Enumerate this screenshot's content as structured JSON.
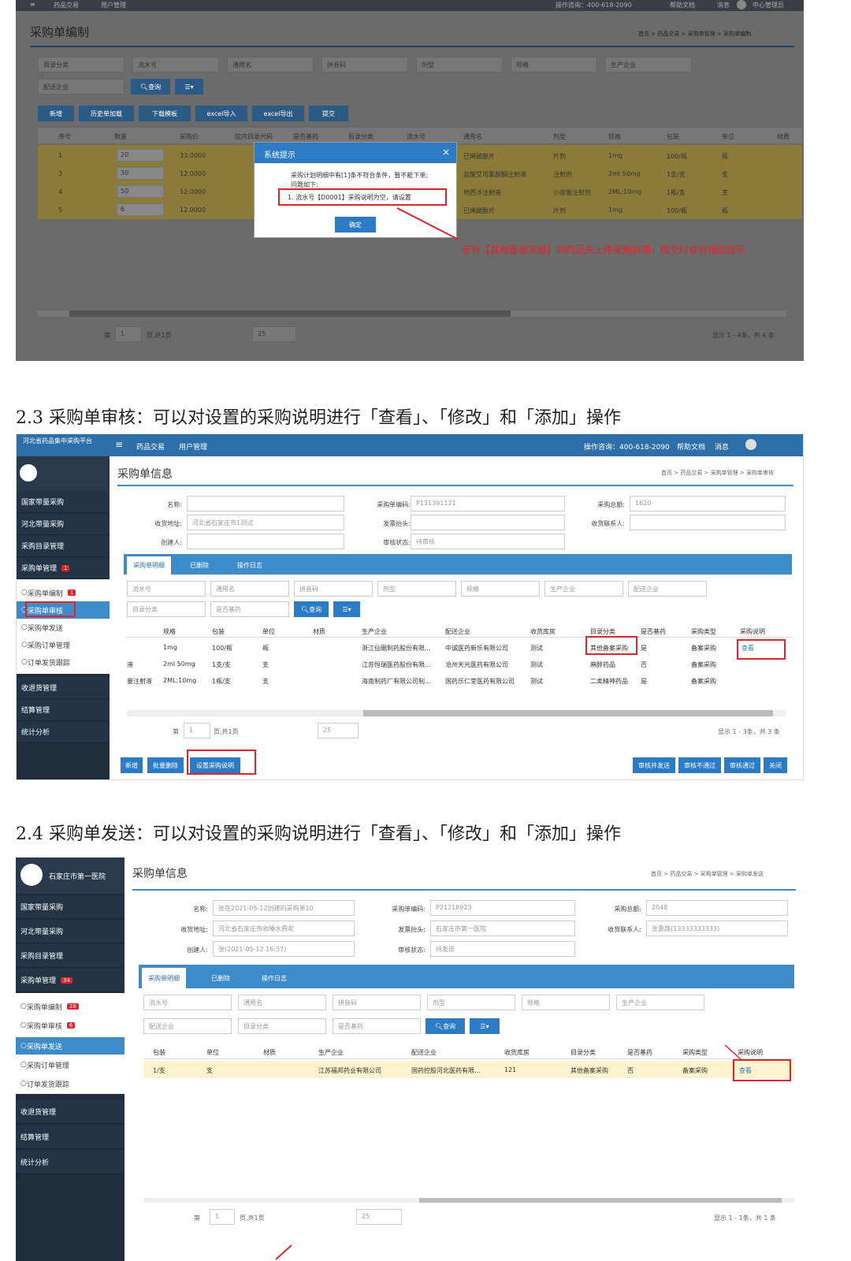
{
  "section1": {
    "topbar": {
      "menu1": "药品交易",
      "menu2": "用户管理",
      "phone": "操作咨询：400-618-2090",
      "help": "帮助文档",
      "msg": "消息",
      "user": "中心管理员"
    },
    "page_title": "采购单编制",
    "breadcrumb": "首页 > 药品交易 > 采购单管理 > 采购单编制",
    "filters": [
      "目录分类",
      "流水号",
      "通用名",
      "拼音码",
      "剂型",
      "规格",
      "生产企业",
      "配送企业"
    ],
    "search_btn": "查询",
    "toolbar": [
      "新增",
      "历史单加载",
      "下载模板",
      "excel导入",
      "excel导出",
      "提交"
    ],
    "columns": [
      "序号",
      "数量",
      "采购价",
      "院内目录代码",
      "是否基药",
      "目录分类",
      "流水号",
      "通用名",
      "剂型",
      "规格",
      "包装",
      "单位",
      "材质"
    ],
    "rows": [
      {
        "no": "1",
        "qty": "20",
        "price": "33.0000",
        "name": "已烯雌酚片",
        "form": "片剂",
        "spec": "1mg",
        "pack": "100/瓶",
        "unit": "瓶"
      },
      {
        "no": "3",
        "qty": "30",
        "price": "12.0000",
        "name": "盐酸艾司氯胺酮注射液",
        "form": "注射剂",
        "spec": "2ml 50mg",
        "pack": "1支/支",
        "unit": "支"
      },
      {
        "no": "4",
        "qty": "50",
        "price": "12.0000",
        "name": "地西泮注射液",
        "form": "小容量注射剂",
        "spec": "2ML:10mg",
        "pack": "1瓶/支",
        "unit": "支"
      },
      {
        "no": "5",
        "qty": "6",
        "price": "12.0000",
        "name": "已烯雌酚片",
        "form": "片剂",
        "spec": "1mg",
        "pack": "100/瓶",
        "unit": "瓶"
      }
    ],
    "dialog": {
      "title": "系统提示",
      "line1": "采购计划明细中有[1]条不符合条件，暂不能下单;",
      "line2": "问题如下:",
      "item": "1. 流水号【D0001】采购说明为空，请设置",
      "ok": "确定"
    },
    "annotation": "若有【其他备案采购】的药品未上传采购说明，提交时会有相应提示",
    "pager": {
      "page_label": "第",
      "page": "1",
      "total": "页,共1页",
      "size": "25",
      "summary": "显示 1 - 4条，共 4 条"
    }
  },
  "heading2": "2.3 采购单审核：可以对设置的采购说明进行「查看」、「修改」和「添加」操作",
  "section2": {
    "brand": "河北省药品集中采购平台",
    "topbar": {
      "menu1": "药品交易",
      "menu2": "用户管理",
      "phone": "操作咨询：400-618-2090",
      "help": "帮助文档",
      "msg": "消息"
    },
    "sidebar": [
      {
        "label": "国家带量采购"
      },
      {
        "label": "河北带量采购"
      },
      {
        "label": "采购目录管理"
      },
      {
        "label": "采购单管理",
        "badge": "1"
      }
    ],
    "subitems": [
      {
        "label": "采购单编制",
        "badge": "1"
      },
      {
        "label": "采购单审核"
      },
      {
        "label": "采购单发送"
      },
      {
        "label": "采购订单管理"
      },
      {
        "label": "订单发货跟踪"
      }
    ],
    "sidebar2": [
      {
        "label": "收退货管理"
      },
      {
        "label": "结算管理"
      },
      {
        "label": "统计分析"
      }
    ],
    "page_title": "采购单信息",
    "breadcrumb": "首页 > 药品交易 > 采购单管理 > 采购单审核",
    "form": {
      "name_label": "名称:",
      "code_label": "采购单编码:",
      "code": "P131391121",
      "total_label": "采购总额:",
      "total": "1620",
      "addr_label": "收货地址:",
      "addr": "河北省石家庄市1测试",
      "invoice_label": "发票抬头:",
      "contact_label": "收货联系人:",
      "creator_label": "创建人:",
      "status_label": "审核状态:",
      "status": "待审核"
    },
    "tabs": [
      "采购单明细",
      "已删除",
      "操作日志"
    ],
    "filters": [
      "流水号",
      "通用名",
      "拼音码",
      "剂型",
      "规格",
      "生产企业",
      "配送企业",
      "目录分类",
      "是否基药"
    ],
    "search_btn": "查询",
    "columns": [
      "规格",
      "包装",
      "单位",
      "材质",
      "生产企业",
      "配送企业",
      "收货库房",
      "目录分类",
      "是否基药",
      "采购类型",
      "采购说明"
    ],
    "rows": [
      {
        "lead": "",
        "spec": "1mg",
        "pack": "100/瓶",
        "unit": "瓶",
        "maker": "浙江仙琚制药股份有限...",
        "dist": "中诚医药新乐有限公司",
        "store": "测试",
        "cat": "其他备案采购",
        "base": "是",
        "type": "备案采购",
        "note": "查看"
      },
      {
        "lead": "液",
        "spec": "2ml 50mg",
        "pack": "1支/支",
        "unit": "支",
        "maker": "江苏恒瑞医药股份有限...",
        "dist": "沧州天元医药有限公司",
        "store": "测试",
        "cat": "麻醉药品",
        "base": "否",
        "type": "备案采购",
        "note": ""
      },
      {
        "lead": "量注射液",
        "spec": "2ML:10mg",
        "pack": "1瓶/支",
        "unit": "支",
        "maker": "海南制药厂有限公司制...",
        "dist": "国药乐仁堂医药有限公司",
        "store": "测试",
        "cat": "二类精神药品",
        "base": "是",
        "type": "备案采购",
        "note": ""
      }
    ],
    "pager": {
      "page_label": "第",
      "page": "1",
      "total": "页,共1页",
      "size": "25",
      "summary": "显示 1 - 3条，共 3 条"
    },
    "bottom_left": [
      "新增",
      "批量删除",
      "设置采购说明"
    ],
    "bottom_right": [
      "审核并发送",
      "审核不通过",
      "审核通过",
      "关闭"
    ]
  },
  "heading3": "2.4 采购单发送：可以对设置的采购说明进行「查看」、「修改」和「添加」操作",
  "section3": {
    "user": "石家庄市第一医院",
    "sidebar": [
      {
        "label": "国家带量采购"
      },
      {
        "label": "河北带量采购"
      },
      {
        "label": "采购目录管理"
      },
      {
        "label": "采购单管理",
        "badge": "34"
      }
    ],
    "subitems": [
      {
        "label": "采购单编制",
        "badge": "28"
      },
      {
        "label": "采购单审核",
        "badge": "6"
      },
      {
        "label": "采购单发送"
      },
      {
        "label": "采购订单管理"
      },
      {
        "label": "订单发货跟踪"
      }
    ],
    "sidebar2": [
      {
        "label": "收退货管理"
      },
      {
        "label": "结算管理"
      },
      {
        "label": "统计分析"
      }
    ],
    "page_title": "采购单信息",
    "breadcrumb": "首页 > 药品交易 > 采购单管理 > 采购单发送",
    "form": {
      "name_label": "名称:",
      "name": "张在2021-05-12创建的采购单10",
      "code_label": "采购单编码:",
      "code": "P21218923",
      "total_label": "采购总额:",
      "total": "2048",
      "addr_label": "收货地址:",
      "addr": "河北省石家庄市收睡水费呢",
      "invoice_label": "发票抬头:",
      "invoice": "石家庄市第一医院",
      "contact_label": "收货联系人:",
      "contact": "张惠路(13333333333)",
      "creator_label": "创建人:",
      "creator": "张(2021-05-12 16:37)",
      "status_label": "审核状态:",
      "status": "待发送"
    },
    "tabs": [
      "采购单明细",
      "已删除",
      "操作日志"
    ],
    "filters": [
      "流水号",
      "通用名",
      "拼音码",
      "剂型",
      "规格",
      "生产企业",
      "配送企业",
      "目录分类",
      "是否基药"
    ],
    "search_btn": "查询",
    "columns": [
      "包装",
      "单位",
      "材质",
      "生产企业",
      "配送企业",
      "收货库房",
      "目录分类",
      "是否基药",
      "采购类型",
      "采购说明"
    ],
    "rows": [
      {
        "pack": "1/支",
        "unit": "支",
        "mat": "",
        "maker": "江苏福邦药业有限公司",
        "dist": "国药控股河北医药有限...",
        "store": "121",
        "cat": "其他备案采购",
        "base": "否",
        "type": "备案采购",
        "note": "查看"
      }
    ],
    "pager": {
      "page_label": "第",
      "page": "1",
      "total": "页,共1页",
      "size": "25",
      "summary": "显示 1 - 1条，共 1 条"
    }
  }
}
